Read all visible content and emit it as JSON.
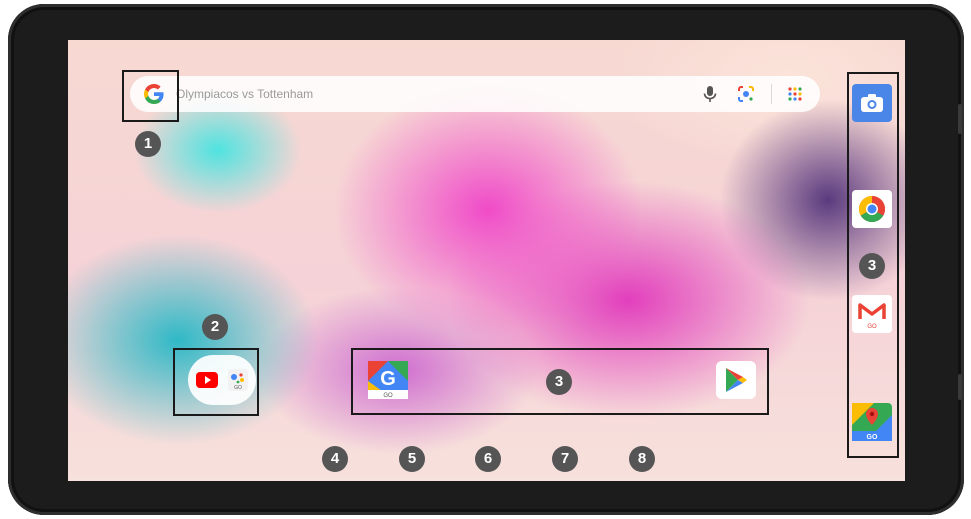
{
  "search": {
    "text": "Olympiacos vs Tottenham",
    "icons": [
      "google-logo-icon",
      "microphone-icon",
      "lens-icon",
      "apps-grid-icon"
    ]
  },
  "folder": {
    "apps": [
      "YouTube",
      "Google Assistant Go"
    ]
  },
  "dock": {
    "apps": [
      "Google Go",
      "Play Store"
    ]
  },
  "rail": {
    "apps": [
      "Camera",
      "Chrome",
      "Gmail Go",
      "Maps Go"
    ]
  },
  "callouts": {
    "n1": "1",
    "n2": "2",
    "n3a": "3",
    "n3b": "3",
    "n4": "4",
    "n5": "5",
    "n6": "6",
    "n7": "7",
    "n8": "8"
  },
  "colors": {
    "callout_bg": "#555555",
    "frame": "#1c1c1c",
    "google_blue": "#4285F4",
    "google_red": "#EA4335",
    "google_yellow": "#FBBC05",
    "google_green": "#34A853"
  }
}
